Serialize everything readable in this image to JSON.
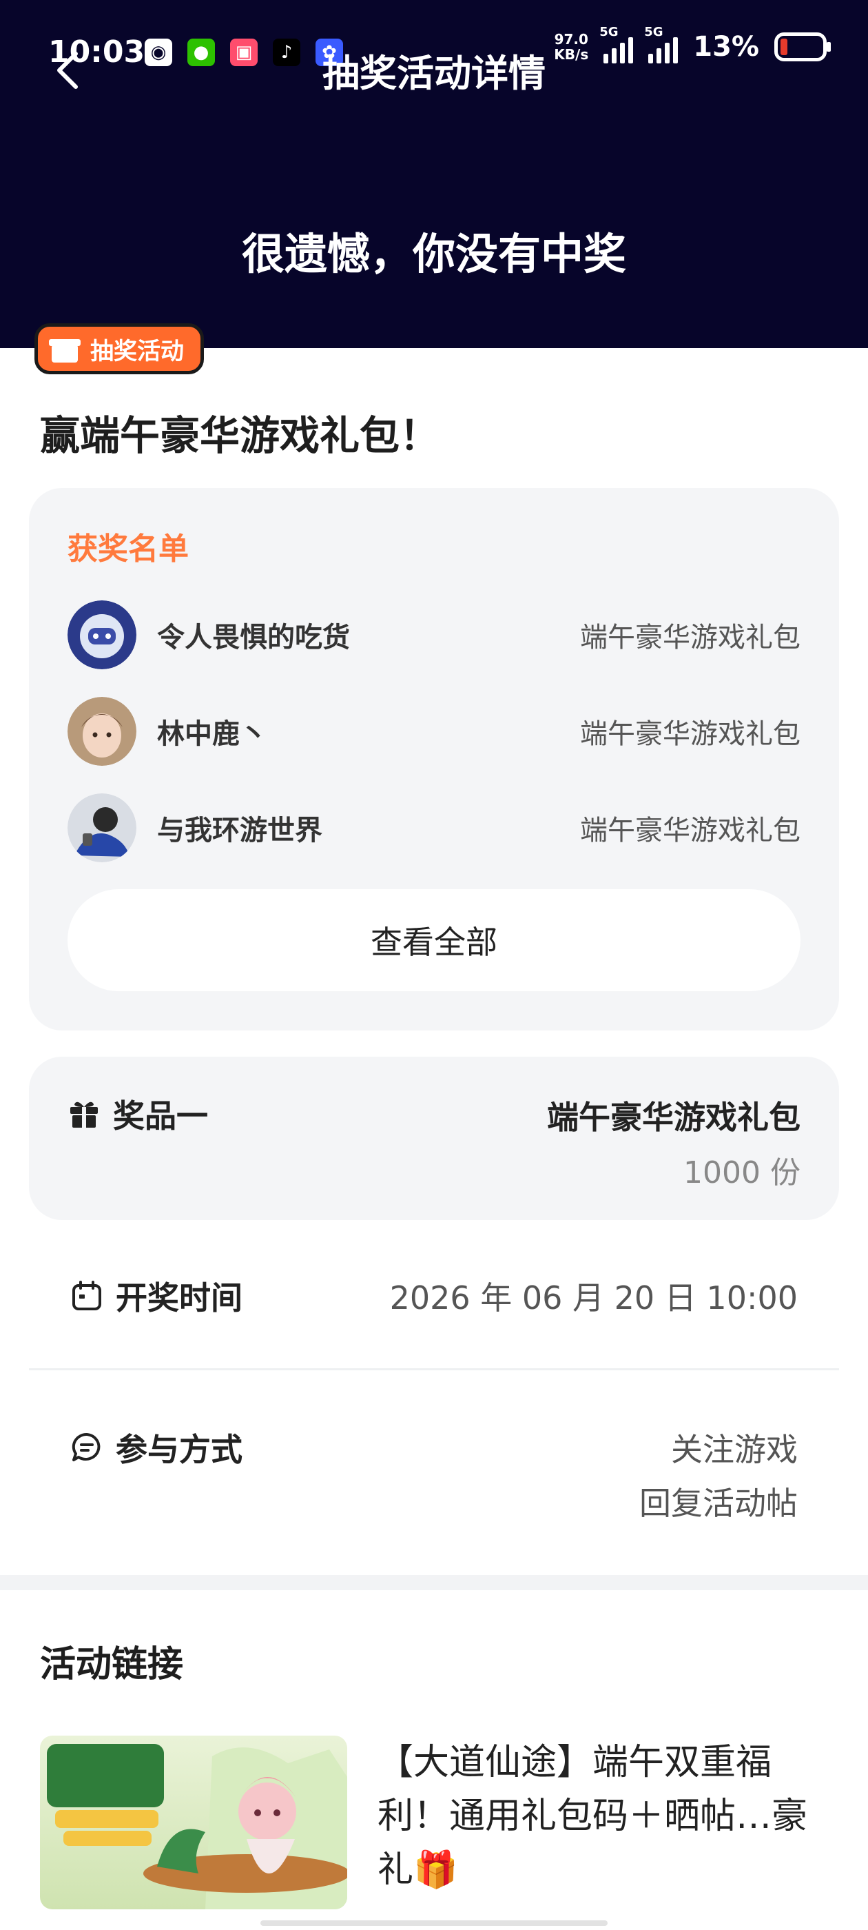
{
  "status_bar": {
    "time": "10:03",
    "notification_icons": [
      "qq-icon",
      "wechat-icon",
      "app-icon",
      "tiktok-icon",
      "app-icon-blue"
    ],
    "net_speed_value": "97.0",
    "net_speed_unit": "KB/s",
    "signal_label": "5G",
    "battery_percent": "13%"
  },
  "header": {
    "title": "抽奖活动详情",
    "result": "很遗憾，你没有中奖",
    "background_color": "#07052a"
  },
  "activity": {
    "tag_label": "抽奖活动",
    "title": "赢端午豪华游戏礼包！"
  },
  "winners": {
    "heading": "获奖名单",
    "list": [
      {
        "name": "令人畏惧的吃货",
        "prize": "端午豪华游戏礼包"
      },
      {
        "name": "林中鹿丶",
        "prize": "端午豪华游戏礼包"
      },
      {
        "name": "与我环游世界",
        "prize": "端午豪华游戏礼包"
      }
    ],
    "view_all_label": "查看全部"
  },
  "prize": {
    "label": "奖品一",
    "name": "端午豪华游戏礼包",
    "quantity": "1000 份"
  },
  "draw_time": {
    "label": "开奖时间",
    "value": "2026 年 06 月 20 日 10:00"
  },
  "participation": {
    "label": "参与方式",
    "methods": [
      "关注游戏",
      "回复活动帖"
    ]
  },
  "links": {
    "heading": "活动链接",
    "items": [
      {
        "title": "【大道仙途】端午双重福利！通用礼包码＋晒帖…豪礼🎁"
      }
    ]
  },
  "colors": {
    "accent": "#ff7a3d",
    "tag": "#ff6a2b",
    "card_bg": "#f4f5f7"
  }
}
